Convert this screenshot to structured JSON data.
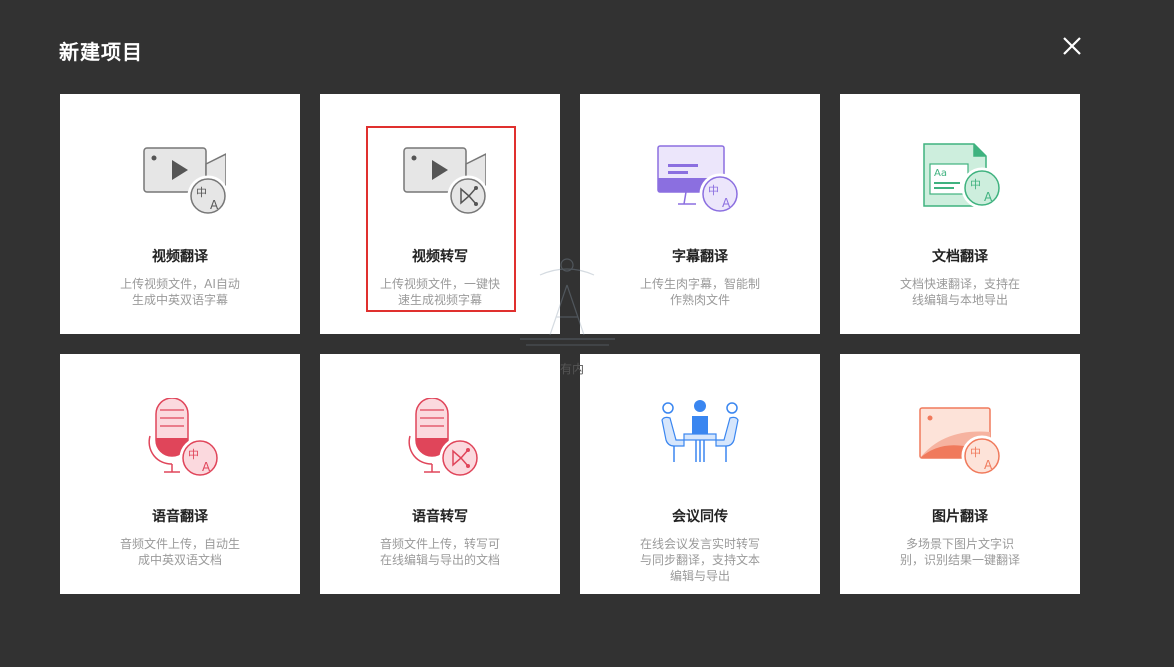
{
  "dialog": {
    "title": "新建项目"
  },
  "cards": [
    {
      "title": "视频翻译",
      "desc": "上传视频文件，AI自动生成中英双语字幕",
      "icon": "video-translate-icon"
    },
    {
      "title": "视频转写",
      "desc": "上传视频文件，一键快速生成视频字幕",
      "icon": "video-transcribe-icon",
      "selected": true
    },
    {
      "title": "字幕翻译",
      "desc": "上传生肉字幕，智能制作熟肉文件",
      "icon": "subtitle-translate-icon"
    },
    {
      "title": "文档翻译",
      "desc": "文档快速翻译，支持在线编辑与本地导出",
      "icon": "document-translate-icon"
    },
    {
      "title": "语音翻译",
      "desc": "音频文件上传，自动生成中英双语文档",
      "icon": "audio-translate-icon"
    },
    {
      "title": "语音转写",
      "desc": "音频文件上传，转写可在线编辑与导出的文档",
      "icon": "audio-transcribe-icon"
    },
    {
      "title": "会议同传",
      "desc": "在线会议发言实时转写与同步翻译，支持文本编辑与导出",
      "icon": "meeting-interpret-icon"
    },
    {
      "title": "图片翻译",
      "desc": "多场景下图片文字识别，识别结果一键翻译",
      "icon": "image-translate-icon"
    }
  ],
  "watermark_text": "有内",
  "colors": {
    "background": "#323232",
    "selected_border": "#e0302e",
    "purple": "#8b6fe0",
    "green": "#3fb27f",
    "pink": "#e0455a",
    "blue": "#3a86f0",
    "orange": "#f07a5c"
  }
}
